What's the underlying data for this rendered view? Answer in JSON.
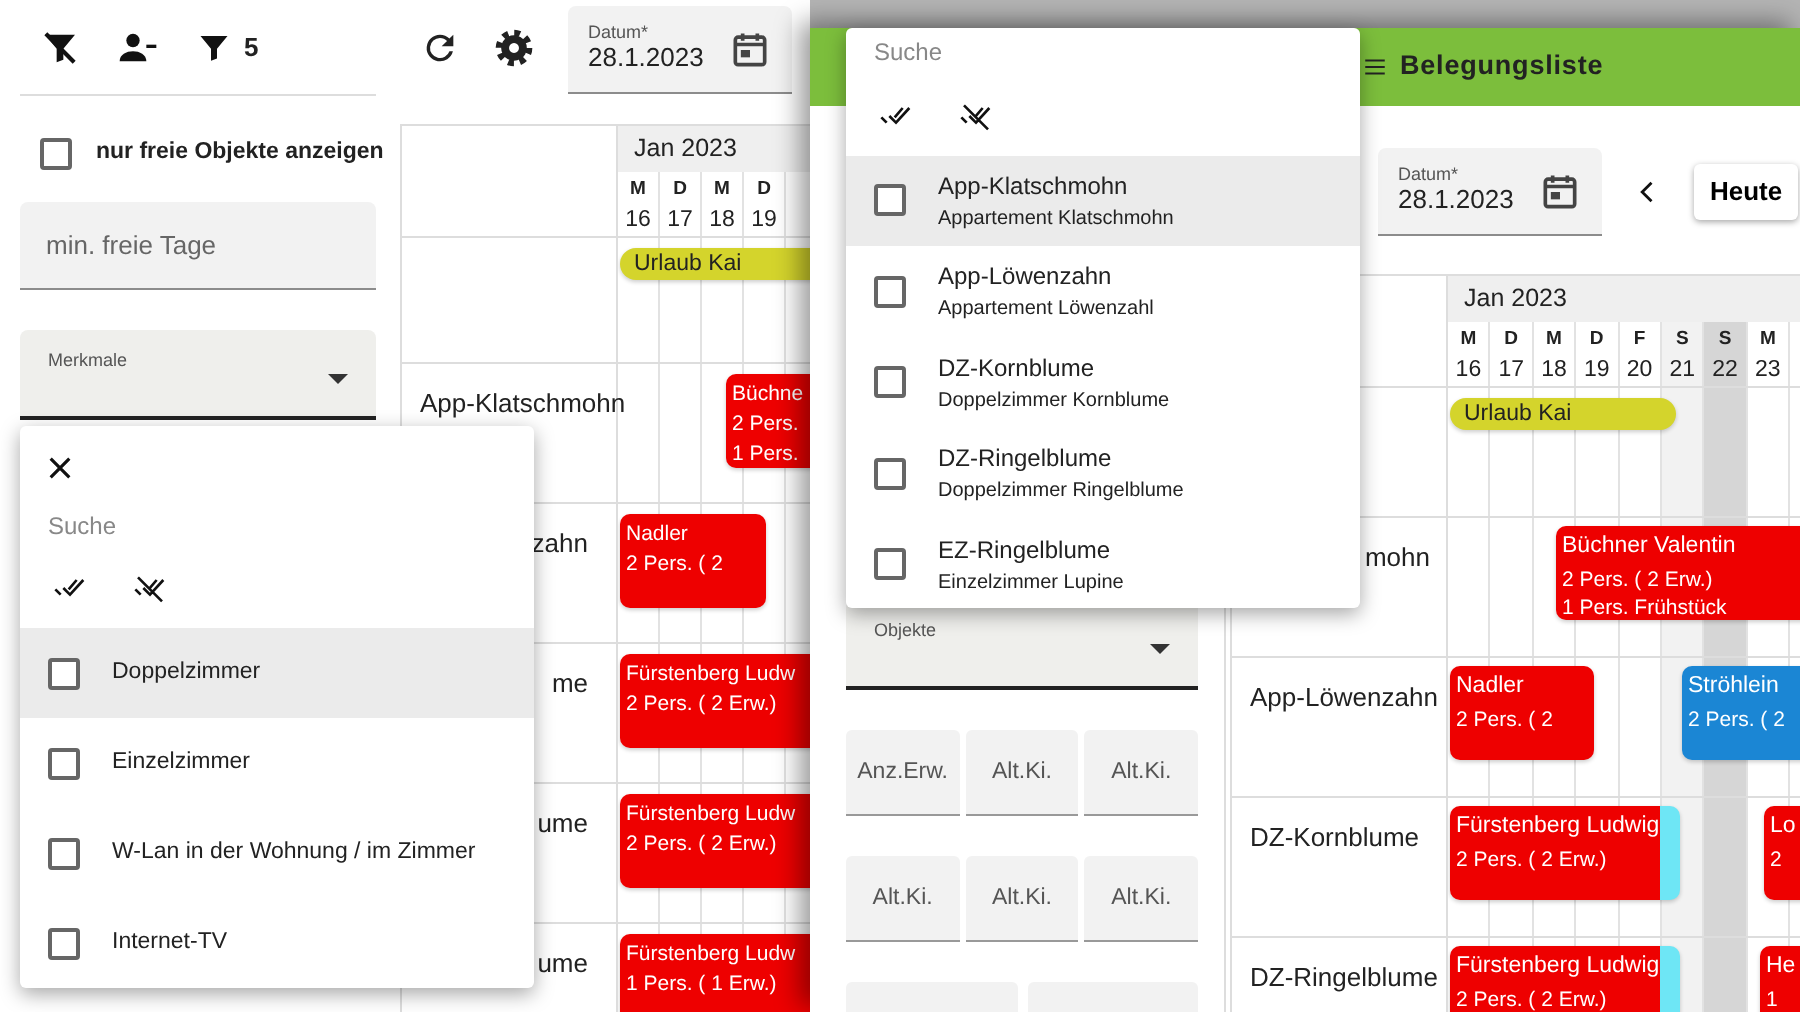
{
  "back_window": {
    "toolbar": {
      "filter_count": "5"
    },
    "free_only": {
      "label": "nur freie Objekte anzeigen",
      "checked": false
    },
    "min_free_days": {
      "placeholder": "min. freie Tage"
    },
    "features_select": {
      "label": "Merkmale"
    },
    "date_field": {
      "label": "Datum*",
      "value": "28.1.2023"
    },
    "calendar": {
      "month": "Jan 2023",
      "days": [
        {
          "weekday": "M",
          "date": "16",
          "kind": "weekday"
        },
        {
          "weekday": "D",
          "date": "17",
          "kind": "weekday"
        },
        {
          "weekday": "M",
          "date": "18",
          "kind": "weekday"
        },
        {
          "weekday": "D",
          "date": "19",
          "kind": "weekday"
        }
      ],
      "rows": [
        {
          "bookings": [
            {
              "kind": "note",
              "lines": [
                "Urlaub Kai"
              ],
              "color": "#d4d42c"
            }
          ]
        },
        {
          "label": "App-Klatschmohn",
          "bookings": [
            {
              "kind": "stay",
              "lines": [
                "Büchne",
                "2 Pers.",
                "1 Pers."
              ],
              "color": "#ee0000"
            }
          ]
        },
        {
          "label": "zahn",
          "bookings": [
            {
              "kind": "stay",
              "lines": [
                "Nadler",
                "2 Pers. ( 2"
              ],
              "color": "#ee0000",
              "departing": false
            }
          ]
        },
        {
          "label": "me",
          "bookings": [
            {
              "kind": "stay",
              "lines": [
                "Fürstenberg Ludw",
                "2 Pers. ( 2 Erw.)"
              ],
              "color": "#ee0000"
            }
          ]
        },
        {
          "label": "ume",
          "bookings": [
            {
              "kind": "stay",
              "lines": [
                "Fürstenberg Ludw",
                "2 Pers. ( 2 Erw.)"
              ],
              "color": "#ee0000"
            }
          ]
        },
        {
          "label": "ume",
          "bookings": [
            {
              "kind": "stay",
              "lines": [
                "Fürstenberg Ludw",
                "1 Pers. ( 1 Erw.)"
              ],
              "color": "#ee0000"
            }
          ]
        }
      ]
    },
    "features_popup": {
      "search": {
        "placeholder": "Suche"
      },
      "items": [
        {
          "title": "Doppelzimmer",
          "checked": false,
          "highlighted": true
        },
        {
          "title": "Einzelzimmer",
          "checked": false,
          "highlighted": false
        },
        {
          "title": "W-Lan in der Wohnung / im Zimmer",
          "checked": false,
          "highlighted": false
        },
        {
          "title": "Internet-TV",
          "checked": false,
          "highlighted": false
        }
      ]
    }
  },
  "front_window": {
    "title": "Belegungsliste",
    "objects_select": {
      "label": "Objekte"
    },
    "count_fields": [
      {
        "placeholder": "Anz.Erw."
      },
      {
        "placeholder": "Alt.Ki."
      },
      {
        "placeholder": "Alt.Ki."
      },
      {
        "placeholder": "Alt.Ki."
      },
      {
        "placeholder": "Alt.Ki."
      },
      {
        "placeholder": "Alt.Ki."
      }
    ],
    "date_field": {
      "label": "Datum*",
      "value": "28.1.2023"
    },
    "today_button": "Heute",
    "calendar": {
      "month": "Jan 2023",
      "days": [
        {
          "weekday": "M",
          "date": "16",
          "kind": "weekday"
        },
        {
          "weekday": "D",
          "date": "17",
          "kind": "weekday"
        },
        {
          "weekday": "M",
          "date": "18",
          "kind": "weekday"
        },
        {
          "weekday": "D",
          "date": "19",
          "kind": "weekday"
        },
        {
          "weekday": "F",
          "date": "20",
          "kind": "weekday"
        },
        {
          "weekday": "S",
          "date": "21",
          "kind": "saturday"
        },
        {
          "weekday": "S",
          "date": "22",
          "kind": "sunday"
        },
        {
          "weekday": "M",
          "date": "23",
          "kind": "weekday"
        }
      ],
      "rows": [
        {
          "bookings": [
            {
              "kind": "note",
              "lines": [
                "Urlaub Kai"
              ],
              "color": "#d4d42c",
              "departing": false
            }
          ]
        },
        {
          "label": "mohn",
          "bookings": [
            {
              "kind": "stay",
              "lines": [
                "Büchner Valentin",
                "2 Pers. ( 2 Erw.)",
                "1 Pers. Frühstück"
              ],
              "color": "#ee0000"
            }
          ]
        },
        {
          "label": "App-Löwenzahn",
          "bookings": [
            {
              "kind": "stay",
              "lines": [
                "Nadler",
                "2 Pers. ( 2"
              ],
              "color": "#ee0000",
              "departing": false
            },
            {
              "kind": "stay",
              "lines": [
                "Ströhlein",
                "2 Pers. ( 2"
              ],
              "color": "#1b86d4"
            }
          ]
        },
        {
          "label": "DZ-Kornblume",
          "bookings": [
            {
              "kind": "stay",
              "lines": [
                "Fürstenberg Ludwig",
                "2 Pers. ( 2 Erw.)"
              ],
              "color": "#ee0000",
              "departing": true
            },
            {
              "kind": "stay",
              "lines": [
                "Lo",
                "2"
              ],
              "color": "#ee0000"
            }
          ]
        },
        {
          "label": "DZ-Ringelblume",
          "bookings": [
            {
              "kind": "stay",
              "lines": [
                "Fürstenberg Ludwig",
                "2 Pers. ( 2 Erw.)"
              ],
              "color": "#ee0000",
              "departing": true
            },
            {
              "kind": "stay",
              "lines": [
                "He",
                "1"
              ],
              "color": "#ee0000"
            }
          ]
        }
      ]
    },
    "objects_popup": {
      "search": {
        "placeholder": "Suche"
      },
      "items": [
        {
          "title": "App-Klatschmohn",
          "subtitle": "Appartement Klatschmohn",
          "checked": false,
          "highlighted": true
        },
        {
          "title": "App-Löwenzahn",
          "subtitle": "Appartement Löwenzahl",
          "checked": false,
          "highlighted": false
        },
        {
          "title": "DZ-Kornblume",
          "subtitle": "Doppelzimmer Kornblume",
          "checked": false,
          "highlighted": false
        },
        {
          "title": "DZ-Ringelblume",
          "subtitle": "Doppelzimmer Ringelblume",
          "checked": false,
          "highlighted": false
        },
        {
          "title": "EZ-Ringelblume",
          "subtitle": "Einzelzimmer Lupine",
          "checked": false,
          "highlighted": false
        }
      ]
    }
  }
}
